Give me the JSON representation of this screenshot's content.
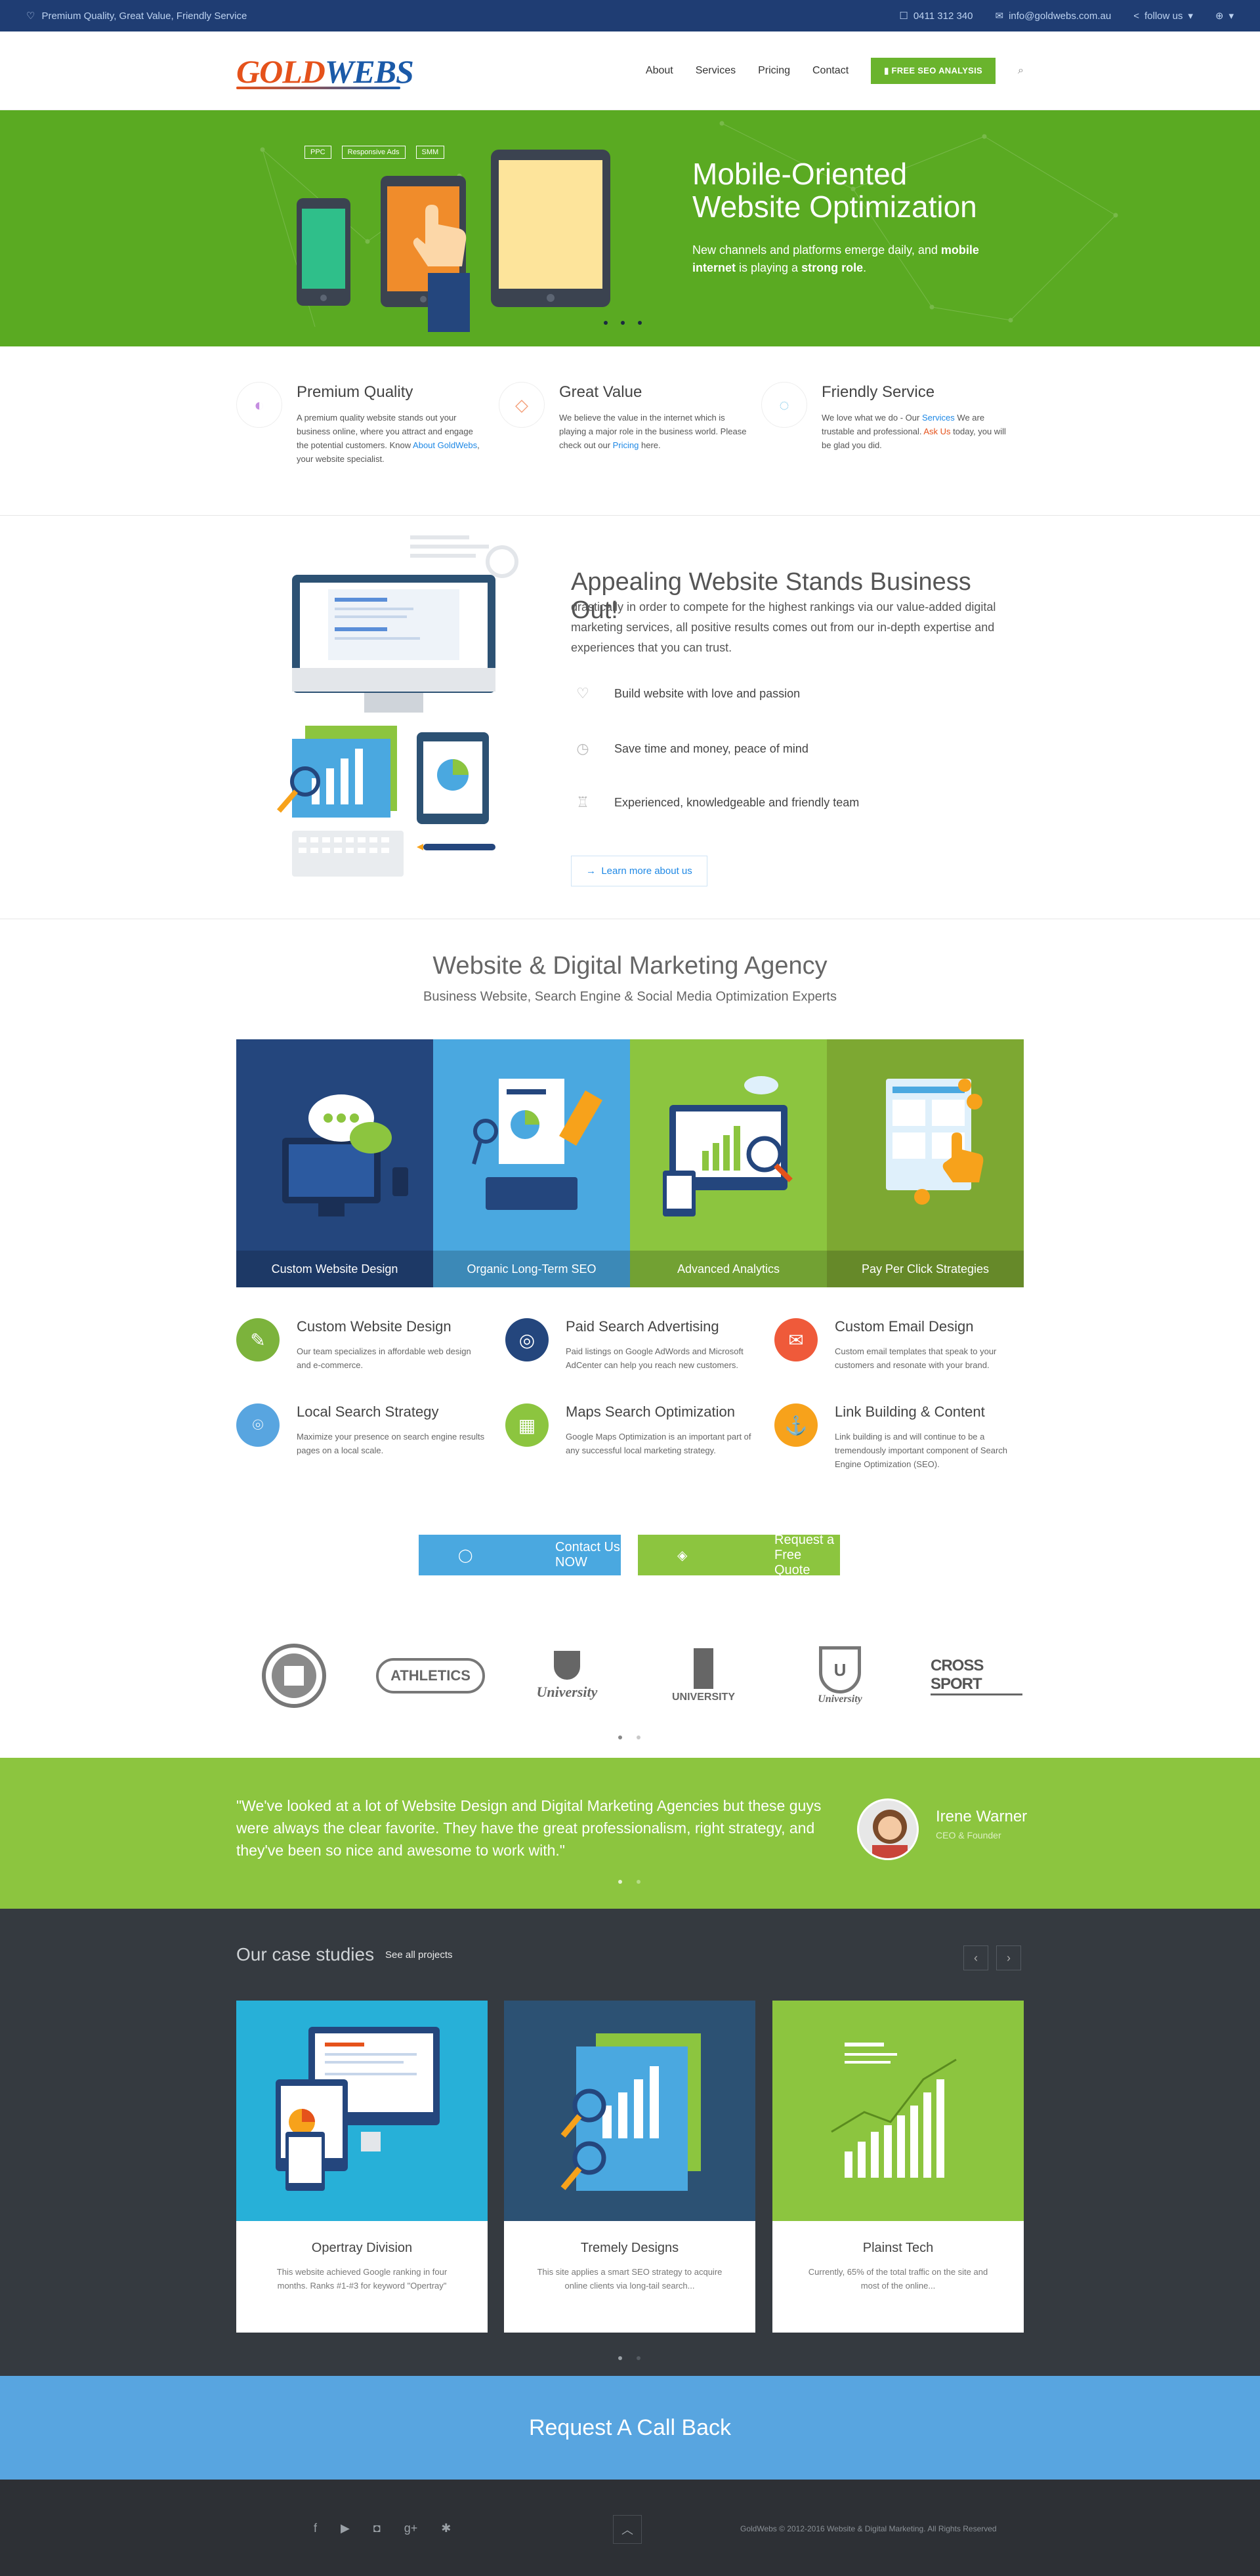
{
  "topbar": {
    "tagline": "Premium Quality, Great Value, Friendly Service",
    "phone": "0411 312 340",
    "email": "info@goldwebs.com.au",
    "follow": "follow us"
  },
  "header": {
    "logo_gold": "GOLD",
    "logo_webs": "WEBS",
    "nav": [
      "About",
      "Services",
      "Pricing",
      "Contact"
    ],
    "cta": "FREE SEO ANALYSIS"
  },
  "hero": {
    "tags": [
      "PPC",
      "Responsive Ads",
      "SMM"
    ],
    "title": "Mobile-Oriented Website Optimization",
    "text_start": "New channels and platforms emerge daily, and ",
    "text_bold1": "mobile internet",
    "text_mid": " is playing a ",
    "text_bold2": "strong role",
    "text_end": "."
  },
  "features": [
    {
      "title": "Premium Quality",
      "t1": "A premium quality website stands out your business online, where you attract and engage the potential customers. Know ",
      "link": "About GoldWebs",
      "t2": ", your website specialist."
    },
    {
      "title": "Great Value",
      "t1": "We believe the value in the internet which is playing a major role in the business world. Please check out our ",
      "link": "Pricing",
      "t2": " here."
    },
    {
      "title": "Friendly Service",
      "t1": "We love what we do - Our ",
      "link": "Services",
      "t2": " We are trustable and professional. ",
      "link2": "Ask Us",
      "t3": " today, you will be glad you did."
    }
  ],
  "appeal": {
    "title": "Appealing Website Stands Business Out!",
    "lead": "drastically in order to compete for the highest rankings via our value-added digital marketing services, all positive results comes out from our in-depth expertise and experiences that you can trust.",
    "items": [
      "Build website with love and passion",
      "Save time and money, peace of mind",
      "Experienced, knowledgeable and friendly team"
    ],
    "button": "Learn more about us"
  },
  "agency": {
    "title": "Website & Digital Marketing Agency",
    "subtitle": "Business Website, Search Engine & Social Media Optimization Experts",
    "tiles": [
      "Custom Website Design",
      "Organic Long-Term SEO",
      "Advanced Analytics",
      "Pay Per Click Strategies"
    ],
    "services": [
      {
        "title": "Custom Website Design",
        "text": "Our team specializes in affordable web design and e-commerce.",
        "color": "#7cb33c"
      },
      {
        "title": "Paid Search Advertising",
        "text": "Paid listings on Google AdWords and Microsoft AdCenter can help you reach new customers.",
        "color": "#24467d"
      },
      {
        "title": "Custom Email Design",
        "text": "Custom email templates that speak to your customers and resonate with your brand.",
        "color": "#ef5a3a"
      },
      {
        "title": "Local Search Strategy",
        "text": "Maximize your presence on search engine results pages on a local scale.",
        "color": "#58a5e0"
      },
      {
        "title": "Maps Search Optimization",
        "text": "Google Maps Optimization is an important part of any successful local marketing strategy.",
        "color": "#8cc53f"
      },
      {
        "title": "Link Building & Content",
        "text": "Link building is and will continue to be a tremendously important component of Search Engine Optimization (SEO).",
        "color": "#f7a21b"
      }
    ],
    "btn_contact": "Contact Us NOW",
    "btn_quote": "Request a Free Quote"
  },
  "clients": [
    "",
    "ATHLETICS",
    "University",
    "UNIVERSITY",
    "University",
    "CROSS SPORT"
  ],
  "testimonial": {
    "quote": "\"We've looked at a lot of Website Design and Digital Marketing Agencies but these guys were always the clear favorite. They have the great professionalism, right strategy, and they've been so nice and awesome to work with.\"",
    "name": "Irene Warner",
    "role": "CEO & Founder"
  },
  "cases": {
    "title": "Our case studies",
    "see_all": "See all projects",
    "items": [
      {
        "title": "Opertray Division",
        "text": "This website achieved Google ranking in four months. Ranks #1-#3 for keyword \"Opertray\"",
        "bg": "#27b0d8"
      },
      {
        "title": "Tremely Designs",
        "text": "This site applies a smart SEO strategy to acquire online clients via long-tail search...",
        "bg": "#2c5173"
      },
      {
        "title": "Plainst Tech",
        "text": "Currently, 65% of the total traffic on the site and most of the online...",
        "bg": "#8cc53f"
      }
    ]
  },
  "callback": "Request A Call Back",
  "footer": {
    "copyright": "GoldWebs © 2012-2016 Website & Digital Marketing. All Rights Reserved"
  }
}
